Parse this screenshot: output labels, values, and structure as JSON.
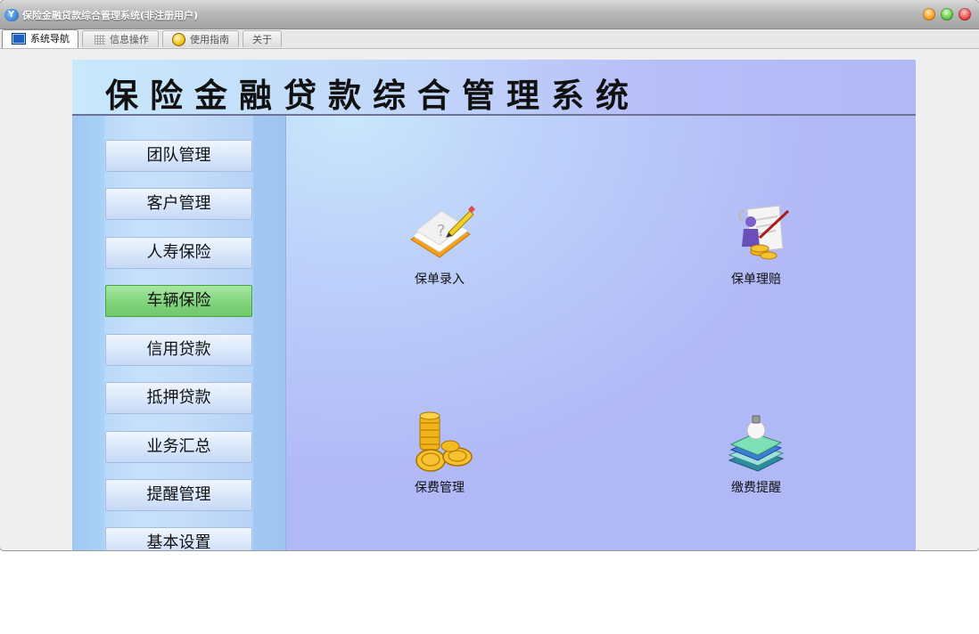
{
  "window": {
    "title": "保险金融贷款综合管理系统(非注册用户)",
    "app_icon_glyph": "Y"
  },
  "tabs": [
    {
      "label": "系统导航",
      "icon": "monitor-icon",
      "active": true
    },
    {
      "label": "信息操作",
      "icon": "grid-icon",
      "active": false
    },
    {
      "label": "使用指南",
      "icon": "help-icon",
      "active": false
    },
    {
      "label": "关于",
      "icon": "",
      "active": false
    }
  ],
  "banner": {
    "title": "保险金融贷款综合管理系统"
  },
  "sidebar": {
    "items": [
      {
        "label": "团队管理",
        "active": false
      },
      {
        "label": "客户管理",
        "active": false
      },
      {
        "label": "人寿保险",
        "active": false
      },
      {
        "label": "车辆保险",
        "active": true
      },
      {
        "label": "信用贷款",
        "active": false
      },
      {
        "label": "抵押贷款",
        "active": false
      },
      {
        "label": "业务汇总",
        "active": false
      },
      {
        "label": "提醒管理",
        "active": false
      },
      {
        "label": "基本设置",
        "active": false
      }
    ]
  },
  "tiles": [
    {
      "label": "保单录入",
      "icon": "pencil-paper-icon"
    },
    {
      "label": "保单理赔",
      "icon": "claim-icon"
    },
    {
      "label": "保费管理",
      "icon": "coins-icon"
    },
    {
      "label": "缴费提醒",
      "icon": "books-bulb-icon"
    }
  ],
  "colors": {
    "active_nav": "#83d67e",
    "panel_background": "#b1b8f6",
    "sidebar_background": "#a8cdf5"
  }
}
